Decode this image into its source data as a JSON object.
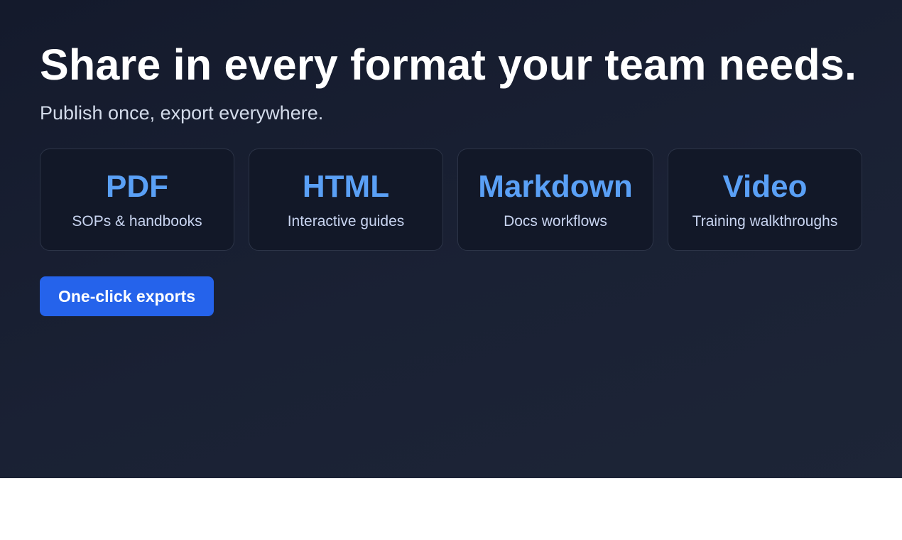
{
  "hero": {
    "headline": "Share in every format your team needs.",
    "subhead": "Publish once, export everywhere.",
    "cta_label": "One-click exports"
  },
  "formats": [
    {
      "name": "PDF",
      "description": "SOPs & handbooks"
    },
    {
      "name": "HTML",
      "description": "Interactive guides"
    },
    {
      "name": "Markdown",
      "description": "Docs workflows"
    },
    {
      "name": "Video",
      "description": "Training walkthroughs"
    }
  ],
  "colors": {
    "hero_background": "#181f31",
    "accent": "#5aa0f6",
    "button": "#2563eb"
  }
}
